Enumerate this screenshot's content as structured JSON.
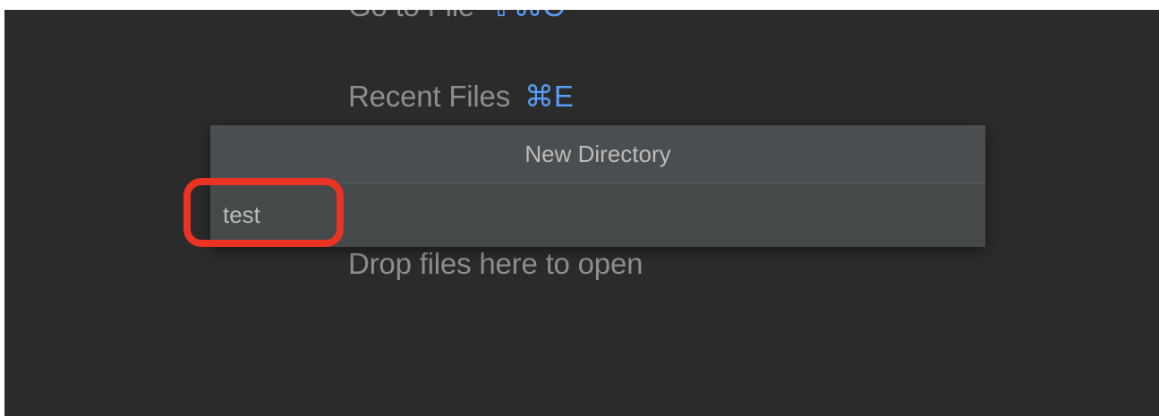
{
  "editor": {
    "hints": {
      "goto_file": {
        "label": "Go to File",
        "shortcut": "⇧⌘O"
      },
      "recent_files": {
        "label": "Recent Files",
        "shortcut": "⌘E"
      },
      "drop_files": {
        "label": "Drop files here to open"
      }
    }
  },
  "new_directory_popup": {
    "title": "New Directory",
    "input_value": "test"
  },
  "annotation": {
    "highlight_color": "#ea3323"
  },
  "colors": {
    "editor_background": "#2b2b2b",
    "hint_text": "#8e8e8e",
    "shortcut_accent": "#589df6",
    "popup_background": "#3c3f41"
  }
}
